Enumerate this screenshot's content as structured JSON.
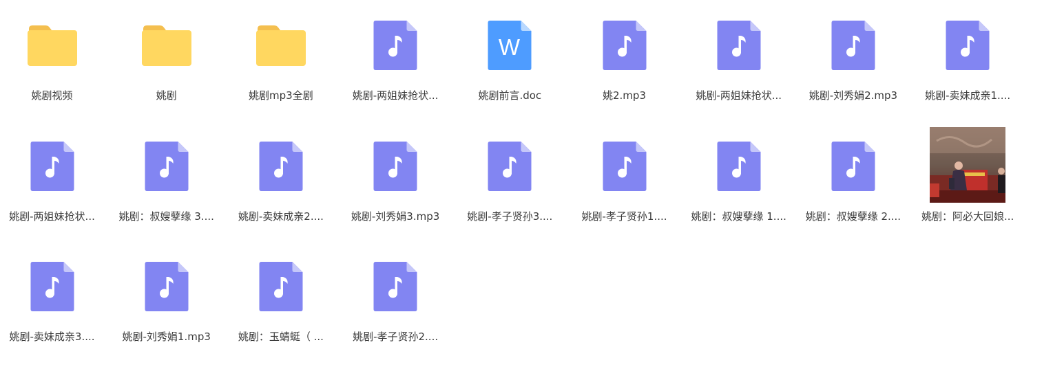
{
  "files": [
    {
      "name": "姚剧视频",
      "icon": "folder-icon"
    },
    {
      "name": "姚剧",
      "icon": "folder-icon"
    },
    {
      "name": "姚剧mp3全剧",
      "icon": "folder-icon"
    },
    {
      "name": "姚剧-两姐妹抢状...",
      "icon": "music-file-icon"
    },
    {
      "name": "姚剧前言.doc",
      "icon": "word-doc-icon",
      "icon_letter": "W"
    },
    {
      "name": "姚2.mp3",
      "icon": "music-file-icon"
    },
    {
      "name": "姚剧-两姐妹抢状...",
      "icon": "music-file-icon"
    },
    {
      "name": "姚剧-刘秀娟2.mp3",
      "icon": "music-file-icon"
    },
    {
      "name": "姚剧-卖妹成亲1....",
      "icon": "music-file-icon"
    },
    {
      "name": "姚剧-两姐妹抢状...",
      "icon": "music-file-icon"
    },
    {
      "name": "姚剧：叔嫂孽缘 3....",
      "icon": "music-file-icon"
    },
    {
      "name": "姚剧-卖妹成亲2....",
      "icon": "music-file-icon"
    },
    {
      "name": "姚剧-刘秀娟3.mp3",
      "icon": "music-file-icon"
    },
    {
      "name": "姚剧-孝子贤孙3....",
      "icon": "music-file-icon"
    },
    {
      "name": "姚剧-孝子贤孙1....",
      "icon": "music-file-icon"
    },
    {
      "name": "姚剧：叔嫂孽缘 1....",
      "icon": "music-file-icon"
    },
    {
      "name": "姚剧：叔嫂孽缘 2....",
      "icon": "music-file-icon"
    },
    {
      "name": "姚剧：阿必大回娘...",
      "icon": "photo-thumbnail"
    },
    {
      "name": "姚剧-卖妹成亲3....",
      "icon": "music-file-icon"
    },
    {
      "name": "姚剧-刘秀娟1.mp3",
      "icon": "music-file-icon"
    },
    {
      "name": "姚剧：玉蜻蜓（ ...",
      "icon": "music-file-icon"
    },
    {
      "name": "姚剧-孝子贤孙2....",
      "icon": "music-file-icon"
    }
  ],
  "colors": {
    "folder_body": "#ffd760",
    "folder_tab": "#f4bf4f",
    "audio_icon": "#8285f2",
    "audio_fold": "#c5c7f9",
    "word_icon": "#4e9cff",
    "word_fold": "#b8d8ff",
    "label_text": "#3a3a3a"
  }
}
